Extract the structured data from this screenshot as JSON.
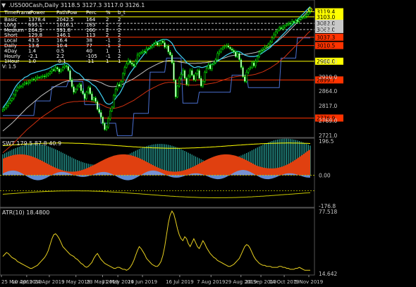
{
  "header": {
    "symbol_line": ".US500Cash,Daily  3118.5 3127.3 3117.0 3126.1",
    "swt_label": "SWT 179.5 87.8 40.9",
    "atr_label": "ATR(10) 18.4800"
  },
  "table": {
    "headers": [
      "TimeFrame",
      "rPower",
      "PathPow",
      "Perc",
      "%",
      "b_t"
    ],
    "rows": [
      {
        "name": "Basic",
        "rpower": "1378.4",
        "pathpow": "2042.5",
        "perc": "164",
        "pct": "2",
        "bt": "2"
      },
      {
        "name": "Long",
        "rpower": "695.1",
        "pathpow": "1016.1",
        "perc": "163",
        "pct": "2",
        "bt": "2"
      },
      {
        "name": "Medium",
        "rpower": "264.3",
        "pathpow": "391.8",
        "perc": "160",
        "pct": "2",
        "bt": "2"
      },
      {
        "name": "Short",
        "rpower": "129.8",
        "pathpow": "146.1",
        "perc": "113",
        "pct": "2",
        "bt": "2"
      },
      {
        "name": "Local",
        "rpower": "43.5",
        "pathpow": "16.4",
        "perc": "38",
        "pct": "-1",
        "bt": "2"
      },
      {
        "name": "Daily",
        "rpower": "13.6",
        "pathpow": "10.4",
        "perc": "77",
        "pct": "-1",
        "bt": "2"
      },
      {
        "name": "4Day",
        "rpower": "1.4",
        "pathpow": "0.5",
        "perc": "40",
        "pct": "1",
        "bt": "1"
      },
      {
        "name": "Hourly",
        "rpower": "-2.1",
        "pathpow": "2.2",
        "perc": "-105",
        "pct": "-1",
        "bt": "2"
      },
      {
        "name": "1Hour",
        "rpower": "1.0",
        "pathpow": "-0.1",
        "perc": "-11",
        "pct": "1",
        "bt": "1"
      }
    ],
    "footer": "V: 1.5"
  },
  "price_axis": {
    "ticks": [
      "3082.0",
      "3062.0",
      "3060.0",
      "2960.0",
      "2910.0",
      "2864.0",
      "2817.0",
      "2769.0",
      "2721.0"
    ],
    "boxes": [
      {
        "label": "3119.4",
        "color": "#ffff00",
        "text_color": "#000000"
      },
      {
        "label": "3103.0",
        "color": "#ffff00",
        "text_color": "#000000"
      },
      {
        "label": "3082.0",
        "color": "#c8c8c8",
        "text_color": "#000000"
      },
      {
        "label": "3062.0",
        "color": "#c8c8c8",
        "text_color": "#000000"
      },
      {
        "label": "3037.3",
        "color": "#ff3300",
        "text_color": "#000000"
      },
      {
        "label": "3010.5",
        "color": "#ff3300",
        "text_color": "#000000"
      },
      {
        "label": "2960.0",
        "color": "#ffff00",
        "text_color": "#000000"
      },
      {
        "label": "2899.7",
        "color": "#ff3300",
        "text_color": "#000000"
      },
      {
        "label": "2776.9",
        "color": "#ff3300",
        "text_color": "#000000"
      }
    ]
  },
  "swt_axis": {
    "ticks": [
      "196.5",
      "0.00",
      "-176.8"
    ]
  },
  "atr_axis": {
    "ticks": [
      "77.518",
      "14.642"
    ]
  },
  "date_axis": {
    "ticks": [
      "25 Mar 2019",
      "10 Apr 2019",
      "24 Apr 2019",
      "9 May 2019",
      "23 May 2019",
      "31 May 2019",
      "24 Jun 2019",
      "16 Jul 2019",
      "7 Aug 2019",
      "29 Aug 2019",
      "20 Sep 2019",
      "14 Oct 2019",
      "5 Nov 2019"
    ]
  },
  "chart_data": [
    {
      "type": "candlestick",
      "title": ".US500Cash,Daily",
      "last_bar": {
        "open": 3118.5,
        "high": 3127.3,
        "low": 3117.0,
        "close": 3126.1
      },
      "ylim": [
        2721,
        3130
      ],
      "close": [
        2805,
        2810,
        2818,
        2825,
        2833,
        2840,
        2852,
        2865,
        2875,
        2878,
        2880,
        2885,
        2890,
        2888,
        2893,
        2898,
        2902,
        2900,
        2905,
        2908,
        2907,
        2910,
        2912,
        2910,
        2915,
        2920,
        2926,
        2933,
        2930,
        2940,
        2935,
        2926,
        2932,
        2940,
        2945,
        2943,
        2930,
        2900,
        2878,
        2860,
        2870,
        2880,
        2885,
        2865,
        2855,
        2840,
        2860,
        2875,
        2855,
        2835,
        2842,
        2830,
        2805,
        2795,
        2780,
        2760,
        2740,
        2748,
        2775,
        2800,
        2812,
        2850,
        2870,
        2885,
        2880,
        2895,
        2920,
        2940,
        2952,
        2962,
        2955,
        2950,
        2945,
        2960,
        2980,
        2985,
        2988,
        2992,
        2990,
        3000,
        3002,
        3005,
        3010,
        3015,
        3020,
        3012,
        3018,
        3025,
        3020,
        3005,
        3010,
        2990,
        2980,
        2955,
        2900,
        2845,
        2880,
        2905,
        2918,
        2930,
        2905,
        2885,
        2912,
        2930,
        2915,
        2900,
        2920,
        2930,
        2905,
        2880,
        2895,
        2925,
        2938,
        2948,
        2935,
        2950,
        2955,
        2965,
        2985,
        2990,
        3000,
        3005,
        3008,
        3010,
        3005,
        3000,
        2995,
        2990,
        2975,
        2985,
        2965,
        2940,
        2910,
        2895,
        2925,
        2935,
        2940,
        2955,
        2945,
        2960,
        2975,
        2990,
        2995,
        2998,
        3005,
        3008,
        3015,
        3022,
        3035,
        3045,
        3055,
        3060,
        3068,
        3065,
        3070,
        3075,
        3078,
        3082,
        3080,
        3088,
        3085,
        3092,
        3088,
        3095,
        3100,
        3102,
        3105,
        3110,
        3118,
        3126
      ],
      "sma_fast": [
        2780,
        2788,
        2796,
        2805,
        2815,
        2825,
        2838,
        2848,
        2856,
        2862,
        2868,
        2872,
        2878,
        2880,
        2883,
        2888,
        2890,
        2892,
        2894,
        2896,
        2897,
        2899,
        2901,
        2902,
        2904,
        2906,
        2909,
        2912,
        2915,
        2918,
        2920,
        2920,
        2920,
        2921,
        2922,
        2923,
        2920,
        2914,
        2908,
        2900,
        2896,
        2892,
        2890,
        2884,
        2878,
        2870,
        2868,
        2866,
        2862,
        2856,
        2852,
        2848,
        2840,
        2832,
        2822,
        2812,
        2800,
        2794,
        2792,
        2792,
        2796,
        2802,
        2810,
        2818,
        2824,
        2834,
        2846,
        2858,
        2870,
        2882,
        2892,
        2900,
        2908,
        2916,
        2925,
        2933,
        2940,
        2948,
        2955,
        2962,
        2968,
        2974,
        2980,
        2986,
        2990,
        2993,
        2996,
        2998,
        3000,
        3000,
        3000,
        2998,
        2994,
        2988,
        2978,
        2965,
        2958,
        2952,
        2946,
        2940,
        2934,
        2926,
        2922,
        2918,
        2914,
        2910,
        2910,
        2912,
        2912,
        2910,
        2910,
        2912,
        2914,
        2916,
        2918,
        2920,
        2922,
        2926,
        2930,
        2934,
        2938,
        2942,
        2946,
        2950,
        2953,
        2956,
        2958,
        2960,
        2960,
        2962,
        2961,
        2958,
        2954,
        2950,
        2948,
        2946,
        2945,
        2945,
        2945,
        2946,
        2948,
        2951,
        2954,
        2958,
        2962,
        2966,
        2970,
        2974,
        2980,
        2986,
        2992,
        2998,
        3004,
        3010,
        3016,
        3022,
        3028,
        3034,
        3040,
        3046,
        3052,
        3058,
        3064,
        3070,
        3076,
        3082,
        3088,
        3094,
        3100,
        3106
      ],
      "sma_slow": [
        2735,
        2740,
        2745,
        2750,
        2755,
        2760,
        2766,
        2772,
        2778,
        2784,
        2790,
        2796,
        2802,
        2808,
        2813,
        2818,
        2823,
        2828,
        2833,
        2838,
        2843,
        2848,
        2852,
        2856,
        2860,
        2864,
        2868,
        2872,
        2876,
        2880,
        2883,
        2886,
        2889,
        2892,
        2894,
        2896,
        2897,
        2898,
        2899,
        2900,
        2900,
        2900,
        2901,
        2901,
        2901,
        2901,
        2901,
        2901,
        2900,
        2899,
        2898,
        2897,
        2895,
        2893,
        2891,
        2888,
        2885,
        2882,
        2880,
        2879,
        2878,
        2878,
        2879,
        2880,
        2882,
        2884,
        2886,
        2889,
        2892,
        2895,
        2898,
        2901,
        2904,
        2908,
        2912,
        2916,
        2920,
        2924,
        2928,
        2932,
        2936,
        2939,
        2942,
        2945,
        2948,
        2951,
        2954,
        2956,
        2958,
        2960,
        2961,
        2962,
        2962,
        2962,
        2961,
        2960,
        2959,
        2958,
        2957,
        2956,
        2955,
        2954,
        2953,
        2953,
        2953,
        2953,
        2953,
        2954,
        2954,
        2954,
        2955,
        2955,
        2956,
        2957,
        2958,
        2959,
        2960,
        2961,
        2963,
        2965,
        2967,
        2969,
        2971,
        2973,
        2975,
        2977,
        2978,
        2979,
        2980,
        2981,
        2982,
        2982,
        2982,
        2982,
        2983,
        2984,
        2985,
        2986,
        2987,
        2988,
        2990,
        2992,
        2994,
        2996,
        2999,
        3002,
        3005,
        3008,
        3012,
        3016,
        3020,
        3024,
        3029,
        3034,
        3039,
        3044,
        3050,
        3056,
        3062,
        3068,
        3074,
        3080,
        3086,
        3092,
        3098,
        3104,
        3110,
        3116,
        3122,
        3127
      ],
      "levels": [
        3119.4,
        3103.0,
        3082.0,
        3062.0,
        3037.3,
        3010.5,
        2960.0,
        2899.7,
        2776.9
      ]
    },
    {
      "type": "area",
      "title": "SWT",
      "values_label": [
        179.5,
        87.8,
        40.9
      ],
      "ylim": [
        -176.8,
        196.5
      ]
    },
    {
      "type": "line",
      "title": "ATR(10)",
      "last_value": 18.48,
      "ylim": [
        14.642,
        77.518
      ],
      "values": [
        32,
        34,
        36,
        35,
        33,
        31,
        30,
        29,
        27,
        26,
        25,
        24,
        23,
        22,
        21,
        20,
        20,
        21,
        22,
        23,
        25,
        27,
        29,
        31,
        34,
        38,
        44,
        50,
        54,
        55,
        53,
        50,
        46,
        42,
        40,
        38,
        36,
        34,
        33,
        32,
        30,
        29,
        27,
        25,
        24,
        22,
        21,
        22,
        24,
        26,
        30,
        33,
        35,
        32,
        29,
        27,
        25,
        24,
        23,
        22,
        21,
        20,
        20,
        21,
        21,
        20,
        19,
        19,
        18,
        19,
        21,
        24,
        28,
        33,
        38,
        42,
        40,
        37,
        34,
        30,
        28,
        26,
        24,
        23,
        22,
        22,
        24,
        27,
        33,
        42,
        54,
        66,
        74,
        78,
        75,
        68,
        60,
        54,
        50,
        48,
        52,
        50,
        45,
        42,
        46,
        50,
        46,
        42,
        40,
        44,
        48,
        45,
        41,
        38,
        35,
        33,
        31,
        30,
        28,
        27,
        26,
        25,
        24,
        23,
        22,
        22,
        23,
        24,
        26,
        28,
        30,
        34,
        38,
        42,
        44,
        43,
        40,
        36,
        32,
        29,
        27,
        25,
        24,
        23,
        23,
        22,
        22,
        22,
        21,
        21,
        21,
        21,
        22,
        22,
        21,
        21,
        20,
        20,
        19,
        19,
        19,
        20,
        20,
        21,
        20,
        19,
        18,
        18,
        18,
        18
      ]
    }
  ]
}
